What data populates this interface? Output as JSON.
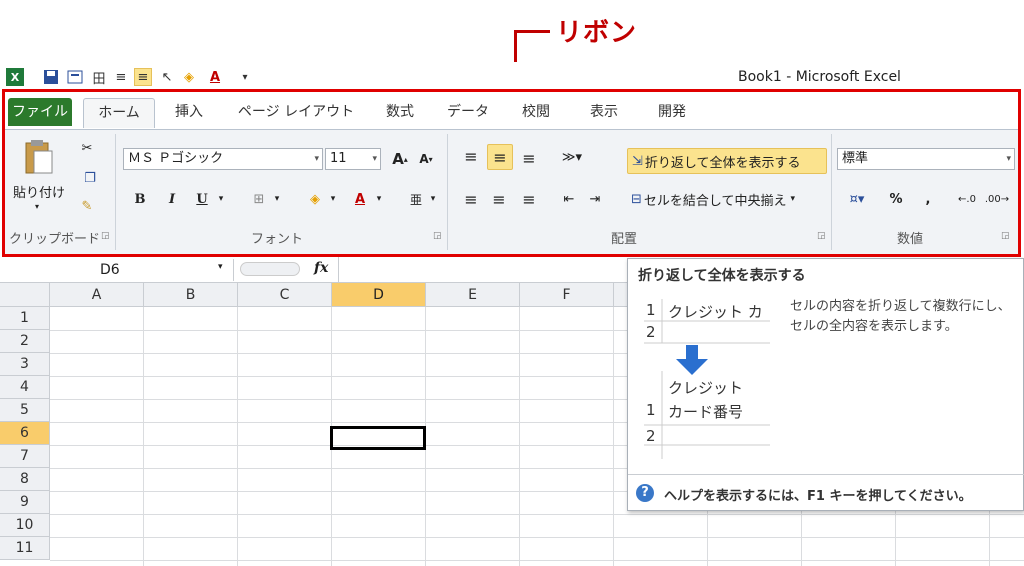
{
  "annotation": {
    "label": "リボン"
  },
  "window": {
    "title": "Book1  -  Microsoft Excel"
  },
  "tabs": [
    "ファイル",
    "ホーム",
    "挿入",
    "ページ レイアウト",
    "数式",
    "データ",
    "校閲",
    "表示",
    "開発"
  ],
  "clipboard": {
    "paste_label": "貼り付け",
    "group_label": "クリップボード"
  },
  "font": {
    "name": "ＭＳ Ｐゴシック",
    "size": "11",
    "group_label": "フォント",
    "bold": "B",
    "italic": "I",
    "underline": "U"
  },
  "alignment": {
    "wrap_label": "折り返して全体を表示する",
    "merge_label": "セルを結合して中央揃え",
    "group_label": "配置"
  },
  "number": {
    "format": "標準",
    "percent": "%",
    "comma": ",",
    "group_label": "数値"
  },
  "formula_bar": {
    "name_box": "D6",
    "fx": "fx"
  },
  "columns": [
    "A",
    "B",
    "C",
    "D",
    "E",
    "F"
  ],
  "rows": [
    "1",
    "2",
    "3",
    "4",
    "5",
    "6",
    "7",
    "8",
    "9",
    "10",
    "11"
  ],
  "tooltip": {
    "title": "折り返して全体を表示する",
    "description": "セルの内容を折り返して複数行にし、セルの全内容を表示します。",
    "example_before_text": "クレジット カ",
    "example_after_line1": "クレジット",
    "example_after_line2": "カード番号",
    "help": "ヘルプを表示するには、F1 キーを押してください。"
  },
  "colors": {
    "annotation": "#e00000",
    "file_tab": "#2c7a2c",
    "selected": "#f9cc6b"
  }
}
